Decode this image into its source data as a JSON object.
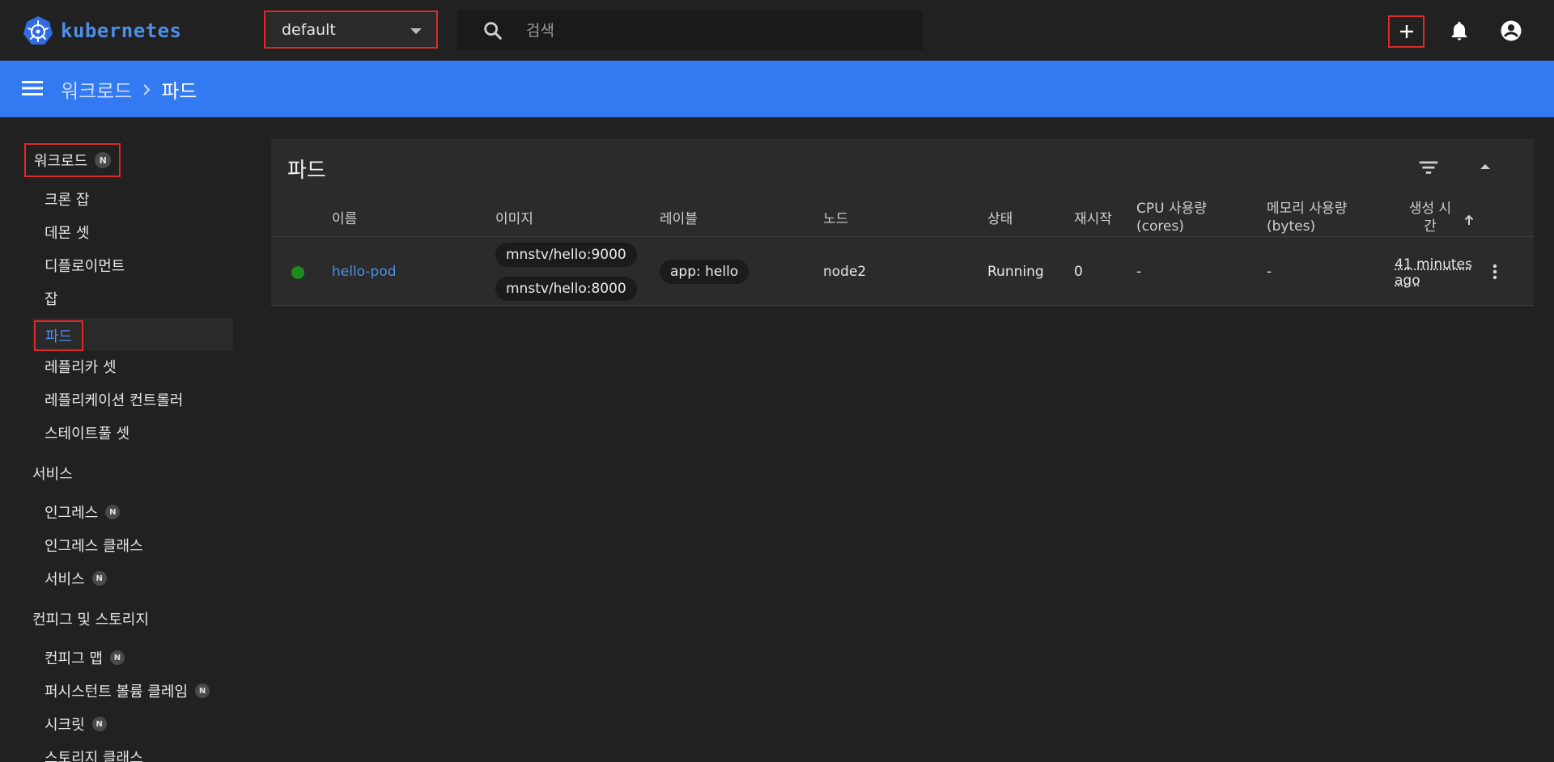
{
  "app": {
    "logo_text": "kubernetes"
  },
  "topbar": {
    "namespace_value": "default",
    "search_placeholder": "검색"
  },
  "breadcrumb": {
    "parent": "워크로드",
    "current": "파드"
  },
  "sidebar": {
    "workloads": {
      "label": "워크로드",
      "badge": "N",
      "items": [
        {
          "label": "크론 잡"
        },
        {
          "label": "데몬 셋"
        },
        {
          "label": "디플로이먼트"
        },
        {
          "label": "잡"
        },
        {
          "label": "파드"
        },
        {
          "label": "레플리카 셋"
        },
        {
          "label": "레플리케이션 컨트롤러"
        },
        {
          "label": "스테이트풀 셋"
        }
      ]
    },
    "services": {
      "label": "서비스",
      "items": [
        {
          "label": "인그레스",
          "badge": "N"
        },
        {
          "label": "인그레스 클래스"
        },
        {
          "label": "서비스",
          "badge": "N"
        }
      ]
    },
    "config": {
      "label": "컨피그 및 스토리지",
      "items": [
        {
          "label": "컨피그 맵",
          "badge": "N"
        },
        {
          "label": "퍼시스턴트 볼륨 클레임",
          "badge": "N"
        },
        {
          "label": "시크릿",
          "badge": "N"
        },
        {
          "label": "스토리지 클래스"
        }
      ]
    }
  },
  "pods_card": {
    "title": "파드",
    "columns": {
      "name": "이름",
      "images": "이미지",
      "labels": "레이블",
      "node": "노드",
      "status": "상태",
      "restarts": "재시작",
      "cpu_line1": "CPU 사용량",
      "cpu_line2": "(cores)",
      "memory_line1": "메모리 사용량",
      "memory_line2": "(bytes)",
      "created_line1": "생성 시",
      "created_line2": "간"
    },
    "rows": [
      {
        "status_color": "#1e8a1e",
        "name": "hello-pod",
        "images": [
          "mnstv/hello:9000",
          "mnstv/hello:8000"
        ],
        "label": "app: hello",
        "node": "node2",
        "status": "Running",
        "restarts": "0",
        "cpu": "-",
        "memory": "-",
        "age_line1": "41 minutes",
        "age_line2": "ago"
      }
    ]
  },
  "colors": {
    "header_blue": "#3279f2",
    "link_blue": "#4d8fe8",
    "highlight_red": "#e02828",
    "background": "#212121"
  }
}
